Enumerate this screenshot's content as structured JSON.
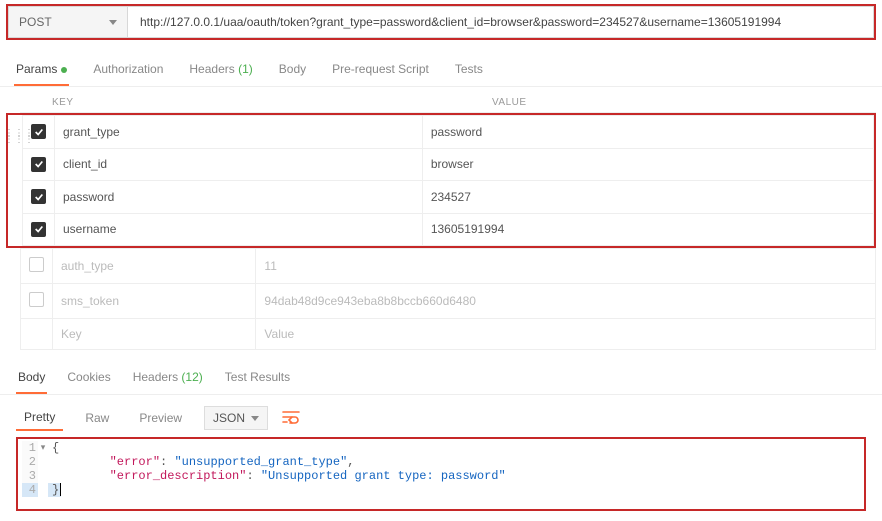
{
  "request": {
    "method": "POST",
    "url": "http://127.0.0.1/uaa/oauth/token?grant_type=password&client_id=browser&password=234527&username=13605191994"
  },
  "tabs": {
    "params": "Params",
    "authorization": "Authorization",
    "headers": "Headers",
    "headers_count": "(1)",
    "body": "Body",
    "prerequest": "Pre-request Script",
    "tests": "Tests"
  },
  "params": {
    "head_key": "KEY",
    "head_value": "VALUE",
    "rows": [
      {
        "checked": true,
        "key": "grant_type",
        "value": "password"
      },
      {
        "checked": true,
        "key": "client_id",
        "value": "browser"
      },
      {
        "checked": true,
        "key": "password",
        "value": "234527"
      },
      {
        "checked": true,
        "key": "username",
        "value": "13605191994"
      }
    ],
    "disabled_rows": [
      {
        "key": "auth_type",
        "value": "11"
      },
      {
        "key": "sms_token",
        "value": "94dab48d9ce943eba8b8bccb660d6480"
      }
    ],
    "placeholder": {
      "key": "Key",
      "value": "Value"
    }
  },
  "resp_tabs": {
    "body": "Body",
    "cookies": "Cookies",
    "headers": "Headers",
    "headers_count": "(12)",
    "test_results": "Test Results"
  },
  "view_bar": {
    "pretty": "Pretty",
    "raw": "Raw",
    "preview": "Preview",
    "json": "JSON"
  },
  "response": {
    "l1": "{",
    "l2_key": "\"error\"",
    "l2_sep": ": ",
    "l2_val": "\"unsupported_grant_type\"",
    "l2_trail": ",",
    "l3_key": "\"error_description\"",
    "l3_sep": ": ",
    "l3_val": "\"Unsupported grant type: password\"",
    "l4": "}"
  }
}
